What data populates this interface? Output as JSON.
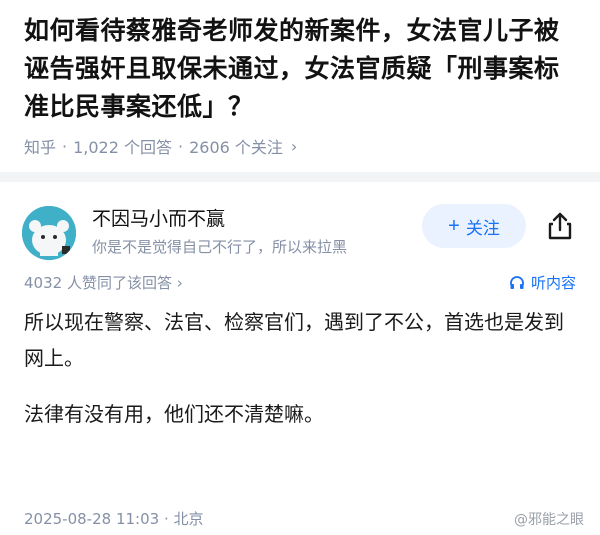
{
  "question": {
    "title": "如何看待蔡雅奇老师发的新案件，女法官儿子被诬告强奸且取保未通过，女法官质疑「刑事案标准比民事案还低」？",
    "source": "知乎",
    "answers": "1,022 个回答",
    "followers": "2606 个关注"
  },
  "author": {
    "name": "不因马小而不赢",
    "headline": "你是不是觉得自己不行了，所以来拉黑",
    "follow_label": "关注"
  },
  "stats": {
    "votes": "4032 人赞同了该回答",
    "listen_label": "听内容"
  },
  "answer": {
    "paragraphs": [
      "所以现在警察、法官、检察官们，遇到了不公，首选也是发到网上。",
      "法律有没有用，他们还不清楚嘛。"
    ],
    "time": "2025-08-28 11:03",
    "location": "北京"
  },
  "watermark": "@邪能之眼",
  "colors": {
    "accent": "#1772f6",
    "meta": "#8590a6",
    "avatar": "#3fb0c7"
  }
}
